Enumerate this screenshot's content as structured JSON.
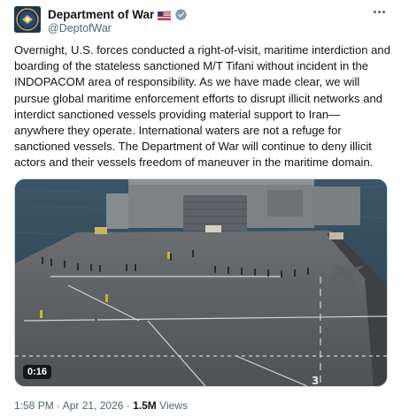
{
  "author": {
    "name": "Department of War",
    "handle": "@DeptofWar",
    "avatar_icon": "department-seal-icon",
    "flag_icon": "us-flag-icon",
    "verified_icon": "verified-badge-icon",
    "verified_color": "#829aab"
  },
  "more_icon": "more-options-icon",
  "post": {
    "text": "Overnight, U.S. forces conducted a right-of-visit, maritime interdiction and boarding of the stateless sanctioned M/T Tifani without incident in the INDOPACOM area of responsibility.  As we have made clear, we will pursue global maritime enforcement efforts to disrupt illicit networks and interdict sanctioned vessels providing material support to Iran—anywhere they operate.  International waters are not a refuge for sanctioned vessels. The Department of War will continue to deny illicit actors and their vessels freedom of maneuver in the maritime domain."
  },
  "media": {
    "type": "video",
    "duration": "0:16",
    "scene": "aircraft-carrier-flight-deck"
  },
  "meta": {
    "time": "1:58 PM",
    "date": "Apr 21, 2026",
    "views_count": "1.5M",
    "views_label": "Views"
  }
}
